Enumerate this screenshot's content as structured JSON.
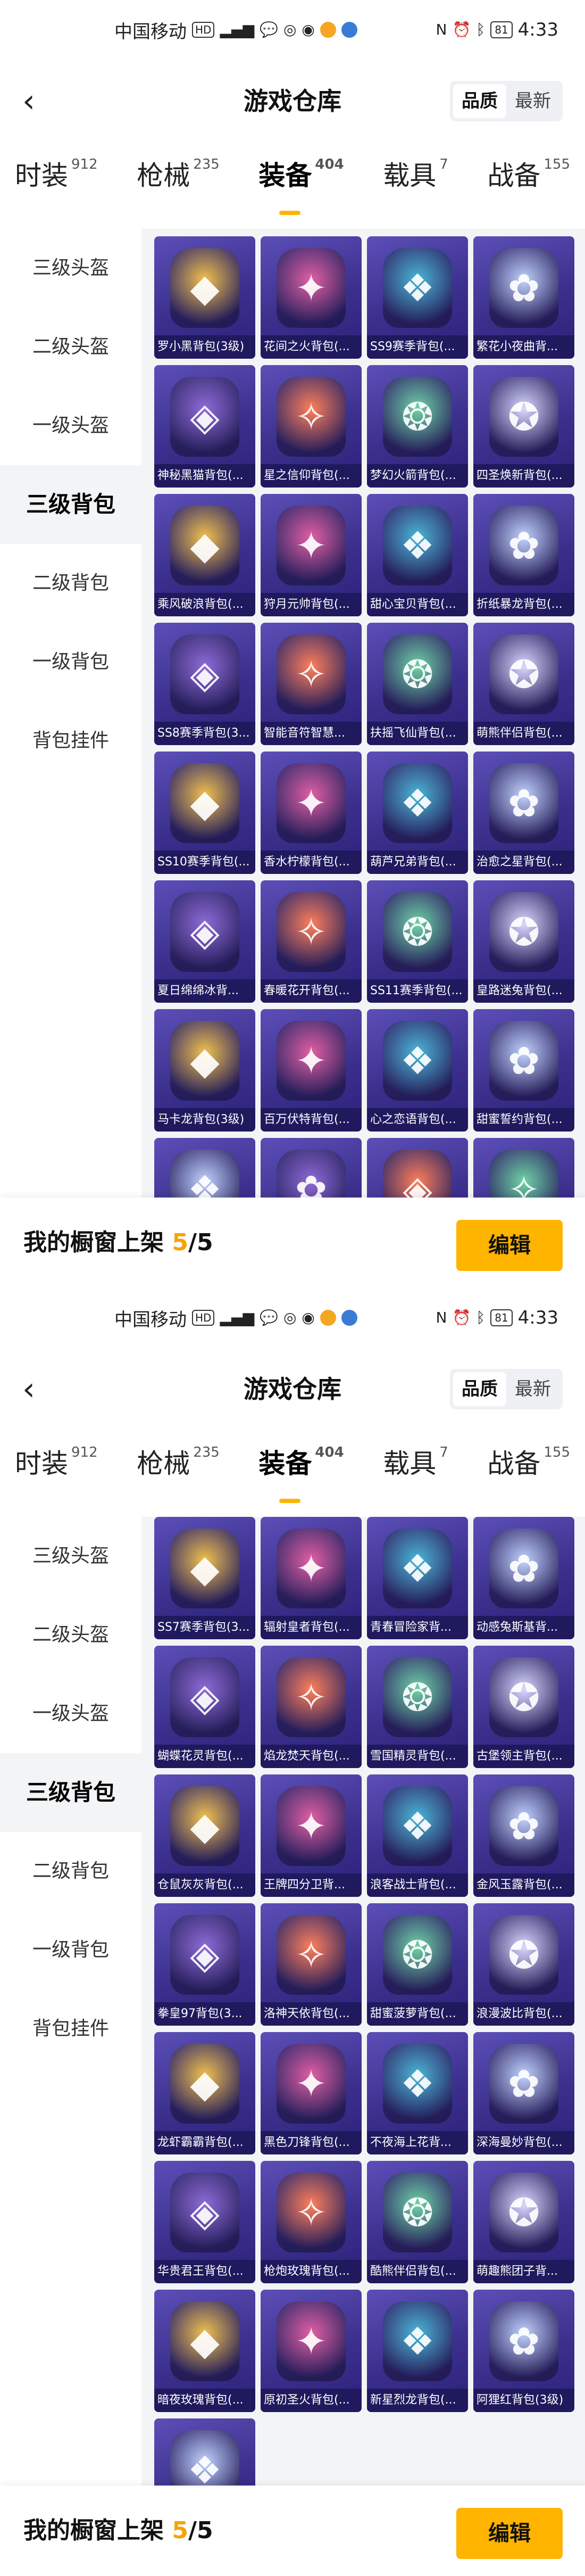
{
  "status": {
    "carrier": "中国移动",
    "battery": "81",
    "time": "4:33"
  },
  "title": "游戏仓库",
  "sort": {
    "options": [
      "品质",
      "最新"
    ]
  },
  "tabs": [
    {
      "label": "时装",
      "count": "912"
    },
    {
      "label": "枪械",
      "count": "235"
    },
    {
      "label": "装备",
      "count": "404"
    },
    {
      "label": "载具",
      "count": "7"
    },
    {
      "label": "战备",
      "count": "155"
    }
  ],
  "sidebar": [
    "三级头盔",
    "二级头盔",
    "一级头盔",
    "三级背包",
    "二级背包",
    "一级背包",
    "背包挂件"
  ],
  "screen1_items": [
    "罗小黑背包(3级)",
    "花间之火背包(...",
    "SS9赛季背包(...",
    "繁花小夜曲背...",
    "神秘黑猫背包(...",
    "星之信仰背包(...",
    "梦幻火箭背包(...",
    "四圣焕新背包(...",
    "乘风破浪背包(...",
    "狩月元帅背包(...",
    "甜心宝贝背包(...",
    "折纸暴龙背包(...",
    "SS8赛季背包(3...",
    "智能音符智慧...",
    "扶摇飞仙背包(...",
    "萌熊伴侣背包(...",
    "SS10赛季背包(...",
    "香水柠檬背包(...",
    "葫芦兄弟背包(...",
    "治愈之星背包(...",
    "夏日绵绵冰背...",
    "春暖花开背包(...",
    "SS11赛季背包(...",
    "皇路迷兔背包(...",
    "马卡龙背包(3级)",
    "百万伏特背包(...",
    "心之恋语背包(...",
    "甜蜜誓约背包(..."
  ],
  "screen2_items": [
    "SS7赛季背包(3...",
    "辐射皇者背包(...",
    "青春冒险家背...",
    "动感兔斯基背...",
    "蝴蝶花灵背包(...",
    "焰龙焚天背包(...",
    "雪国精灵背包(...",
    "古堡领主背包(...",
    "仓鼠灰灰背包(...",
    "王牌四分卫背...",
    "浪客战士背包(...",
    "金风玉露背包(...",
    "拳皇97背包(3...",
    "洛神天依背包(...",
    "甜蜜菠萝背包(...",
    "浪漫波比背包(...",
    "龙虾霸霸背包(...",
    "黑色刀锋背包(...",
    "不夜海上花背...",
    "深海曼妙背包(...",
    "华贵君王背包(...",
    "枪炮玫瑰背包(...",
    "酷熊伴侣背包(...",
    "萌趣熊团子背...",
    "暗夜玫瑰背包(...",
    "原初圣火背包(...",
    "新星烈龙背包(...",
    "阿狸红背包(3级)"
  ],
  "footer": {
    "shelf_label": "我的橱窗上架",
    "shelf_count": "5",
    "shelf_total": "/5",
    "edit_label": "编辑"
  }
}
